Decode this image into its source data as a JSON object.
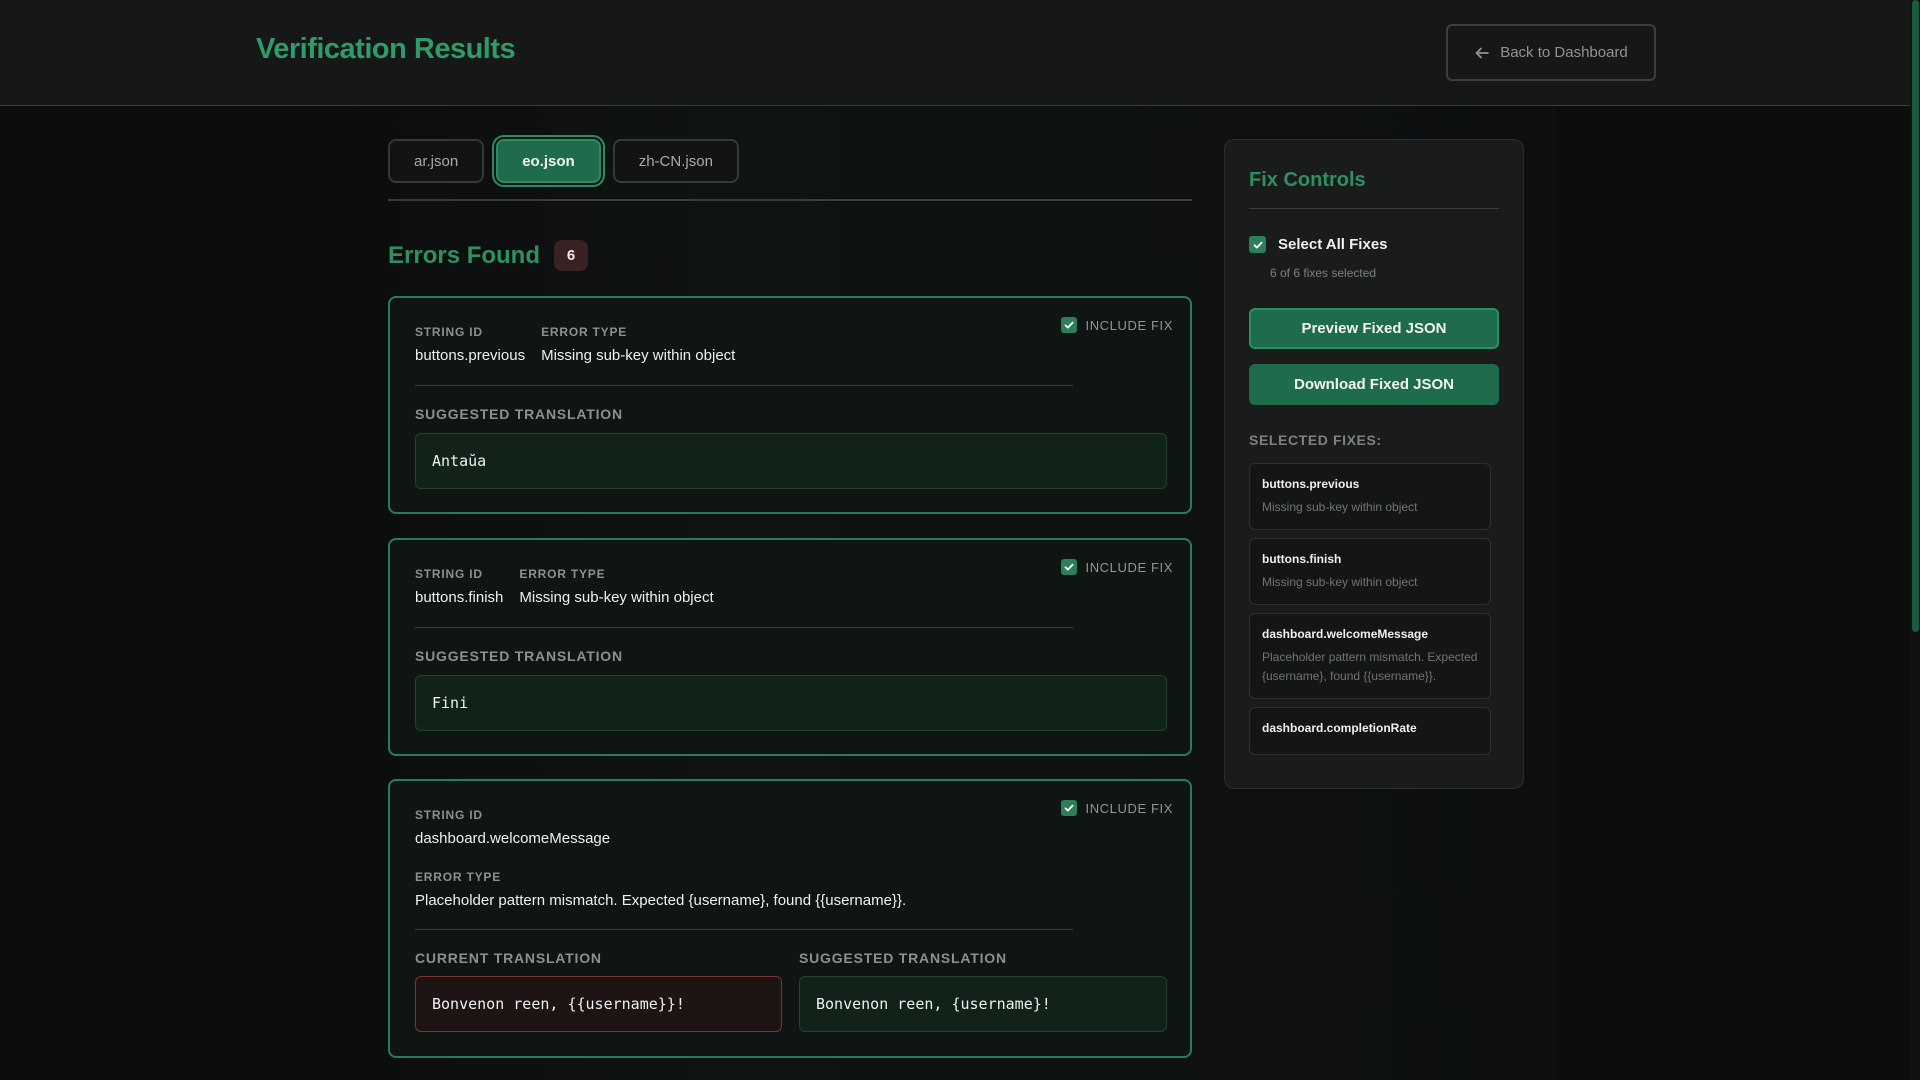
{
  "header": {
    "title": "Verification Results",
    "back_label": "Back to Dashboard"
  },
  "tabs": [
    {
      "label": "ar.json",
      "active": false
    },
    {
      "label": "eo.json",
      "active": true
    },
    {
      "label": "zh-CN.json",
      "active": false
    }
  ],
  "errors": {
    "title": "Errors Found",
    "count": "6",
    "labels": {
      "string_id": "STRING ID",
      "error_type": "ERROR TYPE",
      "include_fix": "INCLUDE FIX",
      "suggested": "SUGGESTED TRANSLATION",
      "current": "CURRENT TRANSLATION"
    },
    "items": [
      {
        "string_id": "buttons.previous",
        "error_type": "Missing sub-key within object",
        "suggested": "Antaŭa",
        "include": true
      },
      {
        "string_id": "buttons.finish",
        "error_type": "Missing sub-key within object",
        "suggested": "Fini",
        "include": true
      },
      {
        "string_id": "dashboard.welcomeMessage",
        "error_type": "Placeholder pattern mismatch. Expected {username}, found {{username}}.",
        "current": "Bonvenon reen, {{username}}!",
        "suggested": "Bonvenon reen, {username}!",
        "include": true
      }
    ]
  },
  "panel": {
    "title": "Fix Controls",
    "select_all_label": "Select All Fixes",
    "select_all_checked": true,
    "selected_count": "6 of 6 fixes selected",
    "preview_label": "Preview Fixed JSON",
    "download_label": "Download Fixed JSON",
    "selected_label": "SELECTED FIXES:",
    "fixes": [
      {
        "key": "buttons.previous",
        "desc": "Missing sub-key within object"
      },
      {
        "key": "buttons.finish",
        "desc": "Missing sub-key within object"
      },
      {
        "key": "dashboard.welcomeMessage",
        "desc": "Placeholder pattern mismatch. Expected {username}, found {{username}}."
      },
      {
        "key": "dashboard.completionRate",
        "desc": ""
      }
    ]
  },
  "colors": {
    "accent": "#2f9a6c",
    "button": "#1f6c4c",
    "error_border": "#7b3434",
    "background": "#0b0c0c"
  },
  "icons": {
    "back": "arrow-left-icon",
    "check": "checkmark-icon"
  }
}
